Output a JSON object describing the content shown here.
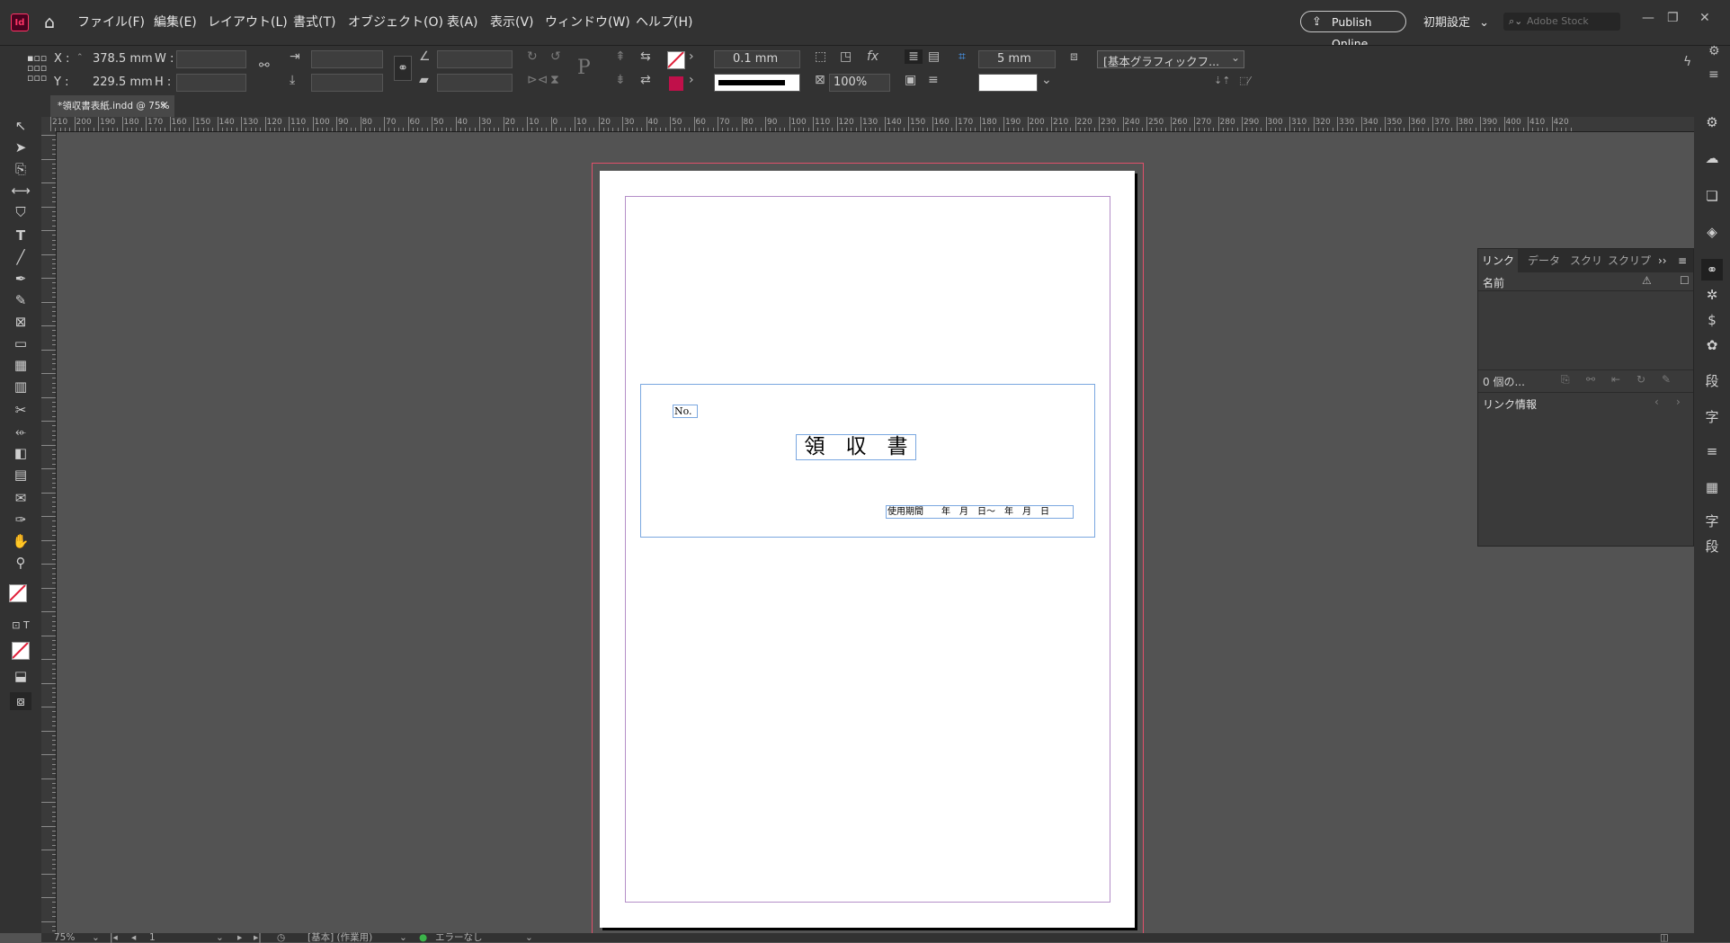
{
  "app": {
    "logo": "Id"
  },
  "menu": [
    "ファイル(F)",
    "編集(E)",
    "レイアウト(L)",
    "書式(T)",
    "オブジェクト(O)",
    "表(A)",
    "表示(V)",
    "ウィンドウ(W)",
    "ヘルプ(H)"
  ],
  "topbar": {
    "publish": "Publish Online",
    "workspace": "初期設定",
    "stock_placeholder": "Adobe Stock"
  },
  "control": {
    "x_label": "X :",
    "x_value": "378.5 mm",
    "y_label": "Y :",
    "y_value": "229.5 mm",
    "w_label": "W :",
    "h_label": "H :",
    "stroke_weight": "0.1 mm",
    "opacity": "100%",
    "frame_offset": "5 mm",
    "object_style": "[基本グラフィックフ..."
  },
  "document_tab": "*領収書表紙.indd @ 75%",
  "ruler_h": [
    "210",
    "200",
    "190",
    "180",
    "170",
    "160",
    "150",
    "140",
    "130",
    "120",
    "110",
    "100",
    "90",
    "80",
    "70",
    "60",
    "50",
    "40",
    "30",
    "20",
    "10",
    "0",
    "10",
    "20",
    "30",
    "40",
    "50",
    "60",
    "70",
    "80",
    "90",
    "100",
    "110",
    "120",
    "130",
    "140",
    "150",
    "160",
    "170",
    "180",
    "190",
    "200",
    "210",
    "220",
    "230",
    "240",
    "250",
    "260",
    "270",
    "280",
    "290",
    "300",
    "310",
    "320",
    "330",
    "340",
    "350",
    "360",
    "370",
    "380",
    "390",
    "400",
    "410",
    "420"
  ],
  "page_content": {
    "no_label": "No.",
    "title": "領　収　書",
    "period": "使用期間　　年　月　日～　年　月　日"
  },
  "links_panel": {
    "tabs": [
      "リンク",
      "データ",
      "スクリ",
      "スクリプ"
    ],
    "col_name": "名前",
    "count": "0 個の...",
    "info": "リンク情報"
  },
  "status": {
    "zoom": "75%",
    "page": "1",
    "master": "[基本] (作業用)",
    "preflight": "エラーなし"
  },
  "colors": {
    "bleed": "#e0506a",
    "margin": "#b48ec8",
    "frame": "#7aa7e0",
    "accent": "#ff3366",
    "fill_swatch": "#c0104a"
  }
}
